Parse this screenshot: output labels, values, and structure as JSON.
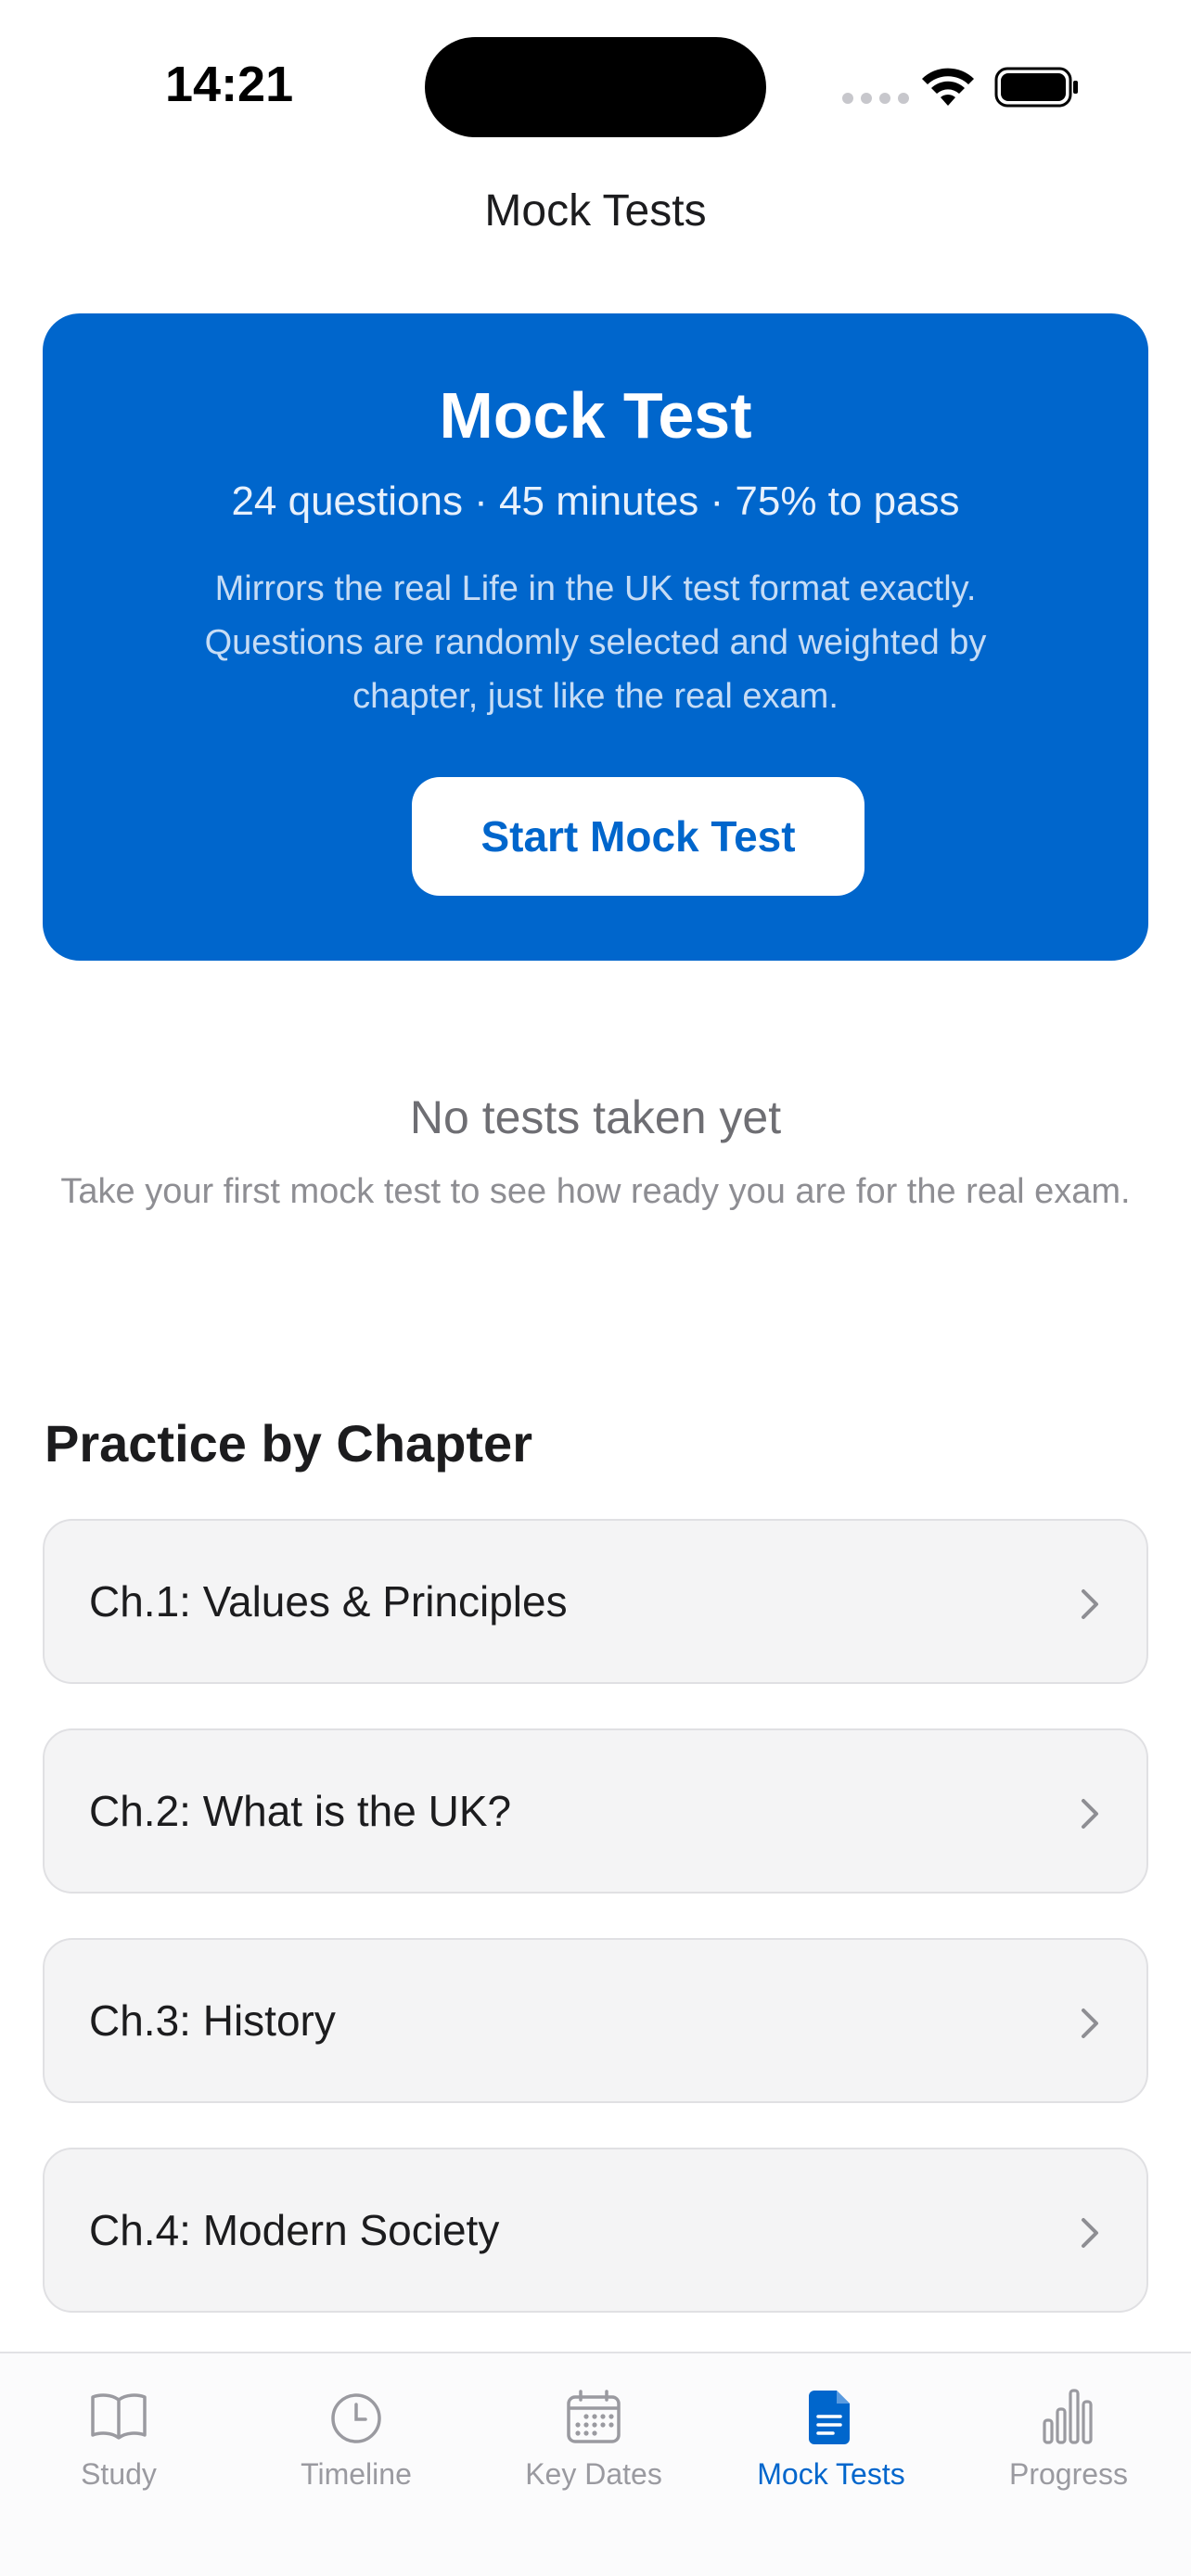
{
  "status_bar": {
    "time": "14:21"
  },
  "nav": {
    "title": "Mock Tests"
  },
  "hero": {
    "title": "Mock Test",
    "meta": "24 questions · 45 minutes · 75% to pass",
    "description": "Mirrors the real Life in the UK test format exactly. Questions are randomly selected and weighted by chapter, just like the real exam.",
    "button_label": "Start Mock Test"
  },
  "empty_state": {
    "title": "No tests taken yet",
    "description": "Take your first mock test to see how ready you are for the real exam."
  },
  "practice": {
    "title": "Practice by Chapter",
    "chapters": [
      {
        "label": "Ch.1: Values & Principles"
      },
      {
        "label": "Ch.2: What is the UK?"
      },
      {
        "label": "Ch.3: History"
      },
      {
        "label": "Ch.4: Modern Society"
      }
    ]
  },
  "tab_bar": {
    "active": "Mock Tests",
    "tabs": [
      {
        "label": "Study",
        "icon": "book-icon"
      },
      {
        "label": "Timeline",
        "icon": "clock-icon"
      },
      {
        "label": "Key Dates",
        "icon": "calendar-icon"
      },
      {
        "label": "Mock Tests",
        "icon": "document-icon"
      },
      {
        "label": "Progress",
        "icon": "bar-chart-icon"
      }
    ]
  },
  "colors": {
    "accent": "#0066cc",
    "card_background": "#f4f4f5",
    "inactive_tab": "#9a9aa0"
  }
}
